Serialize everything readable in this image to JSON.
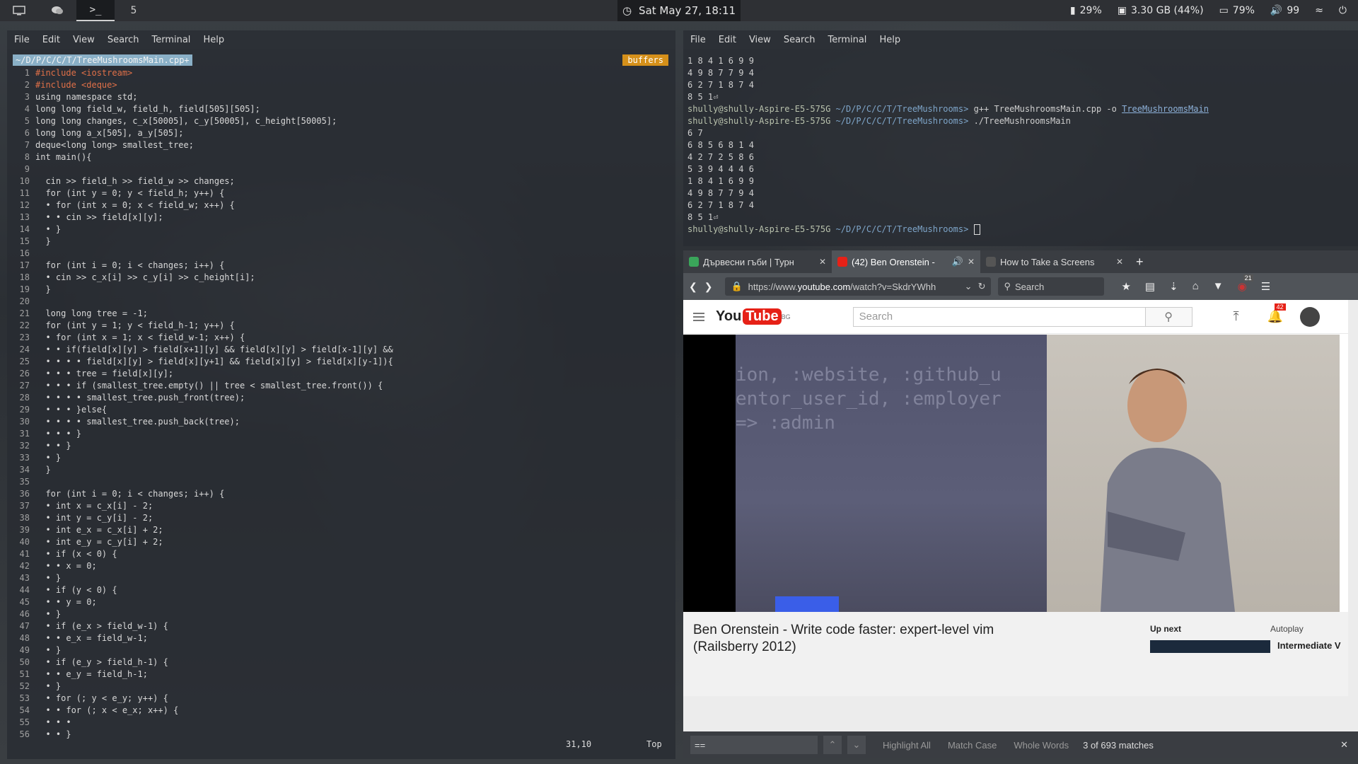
{
  "topbar": {
    "workspace_5": "5",
    "datetime": "Sat May 27, 18:11",
    "battery_device": "29%",
    "disk": "3.30 GB (44%)",
    "battery": "79%",
    "volume": "99"
  },
  "vim": {
    "menu": [
      "File",
      "Edit",
      "View",
      "Search",
      "Terminal",
      "Help"
    ],
    "title": "~/D/P/C/C/T/TreeMushroomsMain.cpp+",
    "buffers": "buffers",
    "position": "31,10",
    "scroll": "Top",
    "lines": [
      "#include <iostream>",
      "#include <deque>",
      "using namespace std;",
      "long long field_w, field_h, field[505][505];",
      "long long changes, c_x[50005], c_y[50005], c_height[50005];",
      "long long a_x[505], a_y[505];",
      "deque<long long> smallest_tree;",
      "int main(){",
      "",
      "  cin >> field_h >> field_w >> changes;",
      "  for (int y = 0; y < field_h; y++) {",
      "  • for (int x = 0; x < field_w; x++) {",
      "  • • cin >> field[x][y];",
      "  • }",
      "  }",
      "",
      "  for (int i = 0; i < changes; i++) {",
      "  • cin >> c_x[i] >> c_y[i] >> c_height[i];",
      "  }",
      "",
      "  long long tree = -1;",
      "  for (int y = 1; y < field_h-1; y++) {",
      "  • for (int x = 1; x < field_w-1; x++) {",
      "  • • if(field[x][y] > field[x+1][y] && field[x][y] > field[x-1][y] &&",
      "  • • • • field[x][y] > field[x][y+1] && field[x][y] > field[x][y-1]){",
      "  • • • tree = field[x][y];",
      "  • • • if (smallest_tree.empty() || tree < smallest_tree.front()) {",
      "  • • • • smallest_tree.push_front(tree);",
      "  • • • }else{",
      "  • • • • smallest_tree.push_back(tree);",
      "  • • • }",
      "  • • }",
      "  • }",
      "  }",
      "",
      "  for (int i = 0; i < changes; i++) {",
      "  • int x = c_x[i] - 2;",
      "  • int y = c_y[i] - 2;",
      "  • int e_x = c_x[i] + 2;",
      "  • int e_y = c_y[i] + 2;",
      "  • if (x < 0) {",
      "  • • x = 0;",
      "  • }",
      "  • if (y < 0) {",
      "  • • y = 0;",
      "  • }",
      "  • if (e_x > field_w-1) {",
      "  • • e_x = field_w-1;",
      "  • }",
      "  • if (e_y > field_h-1) {",
      "  • • e_y = field_h-1;",
      "  • }",
      "  • for (; y < e_y; y++) {",
      "  • • for (; x < e_x; x++) {",
      "  • • •",
      "  • • }"
    ]
  },
  "term": {
    "menu": [
      "File",
      "Edit",
      "View",
      "Search",
      "Terminal",
      "Help"
    ],
    "user": "shully@shully-Aspire-E5-575G",
    "path": "~/D/P/C/C/T/TreeMushrooms",
    "cmd1": "g++ TreeMushroomsMain.cpp -o ",
    "cmd1_out": "TreeMushroomsMain",
    "cmd2": "./TreeMushroomsMain",
    "pre": [
      "1 8 4 1 6 9 9",
      "4 9 8 7 7 9 4",
      "6 2 7 1 8 7 4",
      "8 5 1⏎"
    ],
    "post": [
      "6 7",
      "6 8 5 6 8 1 4",
      "4 2 7 2 5 8 6",
      "5 3 9 4 4 4 6",
      "1 8 4 1 6 9 9",
      "4 9 8 7 7 9 4",
      "6 2 7 1 8 7 4",
      "8 5 1⏎"
    ]
  },
  "browser": {
    "tabs": [
      {
        "title": "Дървесни гъби | Турн",
        "color": "#3aa55a"
      },
      {
        "title": "(42) Ben Orenstein -",
        "color": "#e62117"
      },
      {
        "title": "How to Take a Screens",
        "color": "#555555"
      }
    ],
    "url_prefix": "https://www.",
    "url_host": "youtube.com",
    "url_rest": "/watch?v=SkdrYWhh",
    "search_placeholder": "Search",
    "addon_badge": "21",
    "yt": {
      "region": "BG",
      "search_placeholder": "Search",
      "notif_count": "42",
      "video_title": "Ben Orenstein - Write code faster: expert-level vim (Railsberry 2012)",
      "up_next": "Up next",
      "autoplay": "Autoplay",
      "next_video": "Intermediate V",
      "slide_text": "ion, :website, :github_u\nentor_user_id, :employer\n=> :admin"
    },
    "find": {
      "query": "==",
      "highlight_all": "Highlight All",
      "match_case": "Match Case",
      "whole_words": "Whole Words",
      "matches": "3 of 693 matches"
    }
  }
}
